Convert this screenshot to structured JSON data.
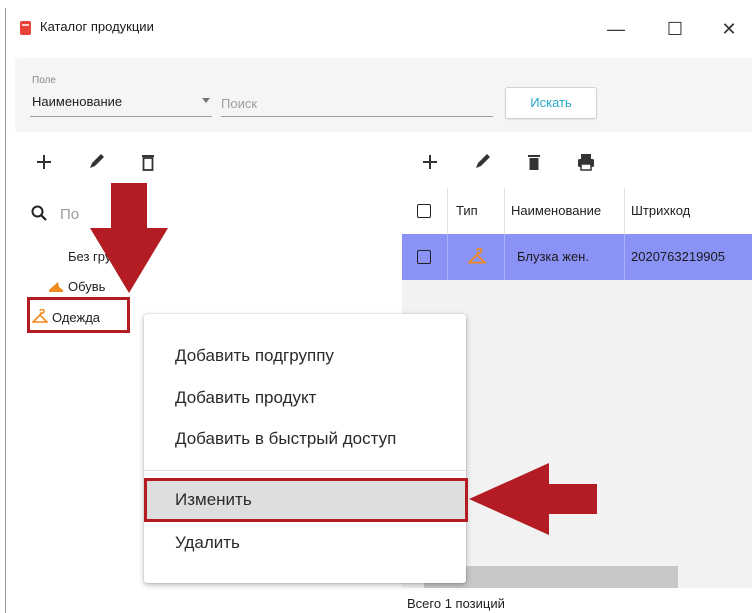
{
  "window": {
    "title": "Каталог продукции",
    "controls": {
      "minimize": "—",
      "maximize": "☐",
      "close": "✕"
    }
  },
  "filter": {
    "field_label": "Поле",
    "field_value": "Наименование",
    "search_placeholder": "Поиск",
    "search_button": "Искать"
  },
  "tree_toolbar": [
    "add-icon",
    "edit-pencil-icon",
    "delete-icon"
  ],
  "grid_toolbar": [
    "add-icon",
    "edit-pencil-icon",
    "delete-icon",
    "print-icon"
  ],
  "tree": {
    "search_placeholder": "По",
    "items": [
      {
        "label": "Без группы",
        "icon": "none"
      },
      {
        "label": "Обувь",
        "icon": "shoe-icon"
      },
      {
        "label": "Одежда",
        "icon": "hanger-icon"
      }
    ]
  },
  "grid": {
    "columns": [
      "",
      "Тип",
      "Наименование",
      "Штрихкод"
    ],
    "rows": [
      {
        "checked": false,
        "type_icon": "hanger-icon",
        "name": "Блузка жен.",
        "barcode": "2020763219905"
      }
    ],
    "status": "Всего 1 позиций"
  },
  "context_menu": {
    "items": [
      "Добавить подгруппу",
      "Добавить продукт",
      "Добавить в быстрый доступ",
      "Изменить",
      "Удалить"
    ],
    "highlighted": "Изменить"
  },
  "colors": {
    "accent": "#26a7c9",
    "selected_row": "#8a93f5",
    "annotation_red": "#b31c22",
    "icon_orange": "#f0891e"
  }
}
